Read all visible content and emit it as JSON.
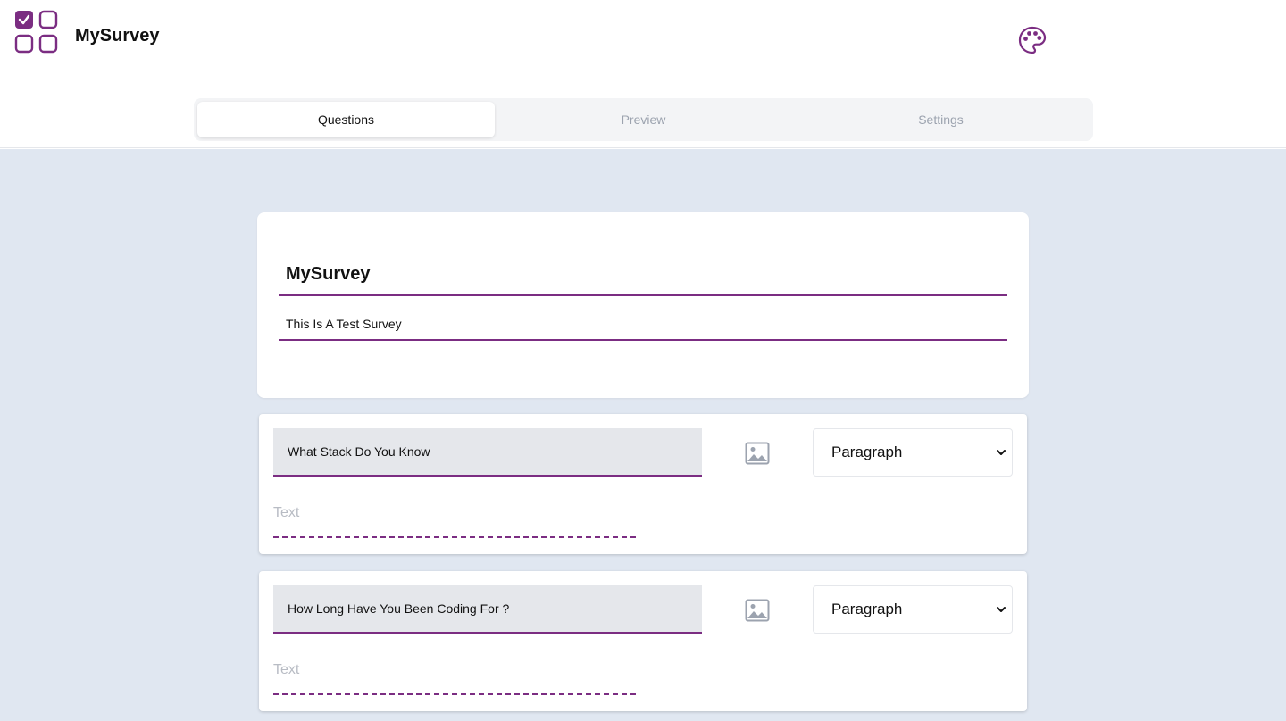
{
  "app": {
    "title": "MySurvey"
  },
  "header": {
    "palette_icon": "palette-icon",
    "logo_icon": "checkbox-grid-logo"
  },
  "tabs": [
    {
      "label": "Questions",
      "active": true
    },
    {
      "label": "Preview",
      "active": false
    },
    {
      "label": "Settings",
      "active": false
    }
  ],
  "survey": {
    "title": "MySurvey",
    "description": "This Is A Test Survey"
  },
  "questions": [
    {
      "text": "What Stack Do You Know",
      "type": "Paragraph",
      "answer_placeholder": "Text",
      "image_icon": "image-icon"
    },
    {
      "text": "How Long Have You Been Coding For ?",
      "type": "Paragraph",
      "answer_placeholder": "Text",
      "image_icon": "image-icon"
    }
  ],
  "colors": {
    "accent": "#7b2d82",
    "background": "#e0e7f1",
    "tab_bar": "#f3f4f6"
  }
}
